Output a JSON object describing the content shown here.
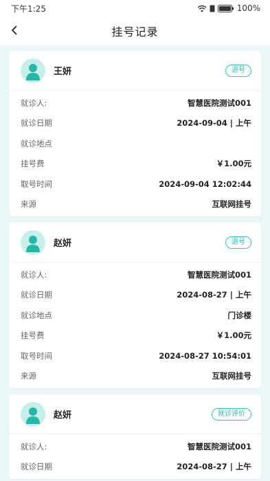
{
  "status": {
    "time": "下午1:25",
    "battery": "100%"
  },
  "header": {
    "title": "挂号记录"
  },
  "records": [
    {
      "name": "王妍",
      "action": "退号",
      "rows": [
        {
          "label": "就诊人:",
          "value": "智慧医院测试001"
        },
        {
          "label": "就诊日期",
          "value": "2024-09-04 | 上午"
        },
        {
          "label": "就诊地点",
          "value": ""
        },
        {
          "label": "挂号费",
          "value": "￥1.00元"
        },
        {
          "label": "取号时间",
          "value": "2024-09-04 12:02:44"
        },
        {
          "label": "来源",
          "value": "互联网挂号"
        }
      ]
    },
    {
      "name": "赵妍",
      "action": "退号",
      "rows": [
        {
          "label": "就诊人:",
          "value": "智慧医院测试001"
        },
        {
          "label": "就诊日期",
          "value": "2024-08-27 | 上午"
        },
        {
          "label": "就诊地点",
          "value": "门诊楼"
        },
        {
          "label": "挂号费",
          "value": "￥1.00元"
        },
        {
          "label": "取号时间",
          "value": "2024-08-27 10:54:01"
        },
        {
          "label": "来源",
          "value": "互联网挂号"
        }
      ]
    },
    {
      "name": "赵妍",
      "action": "就诊评价",
      "rows": [
        {
          "label": "就诊人:",
          "value": "智慧医院测试001"
        },
        {
          "label": "就诊日期",
          "value": "2024-08-27 | 上午"
        }
      ]
    }
  ],
  "colors": {
    "accent": "#37c0b5",
    "avatar_bg": "#c5efe9",
    "page_bg": "#eaf7f6"
  },
  "icons": {
    "back": "chevron-left-icon",
    "avatar": "user-avatar-icon",
    "wifi": "wifi-icon",
    "battery": "battery-icon"
  }
}
